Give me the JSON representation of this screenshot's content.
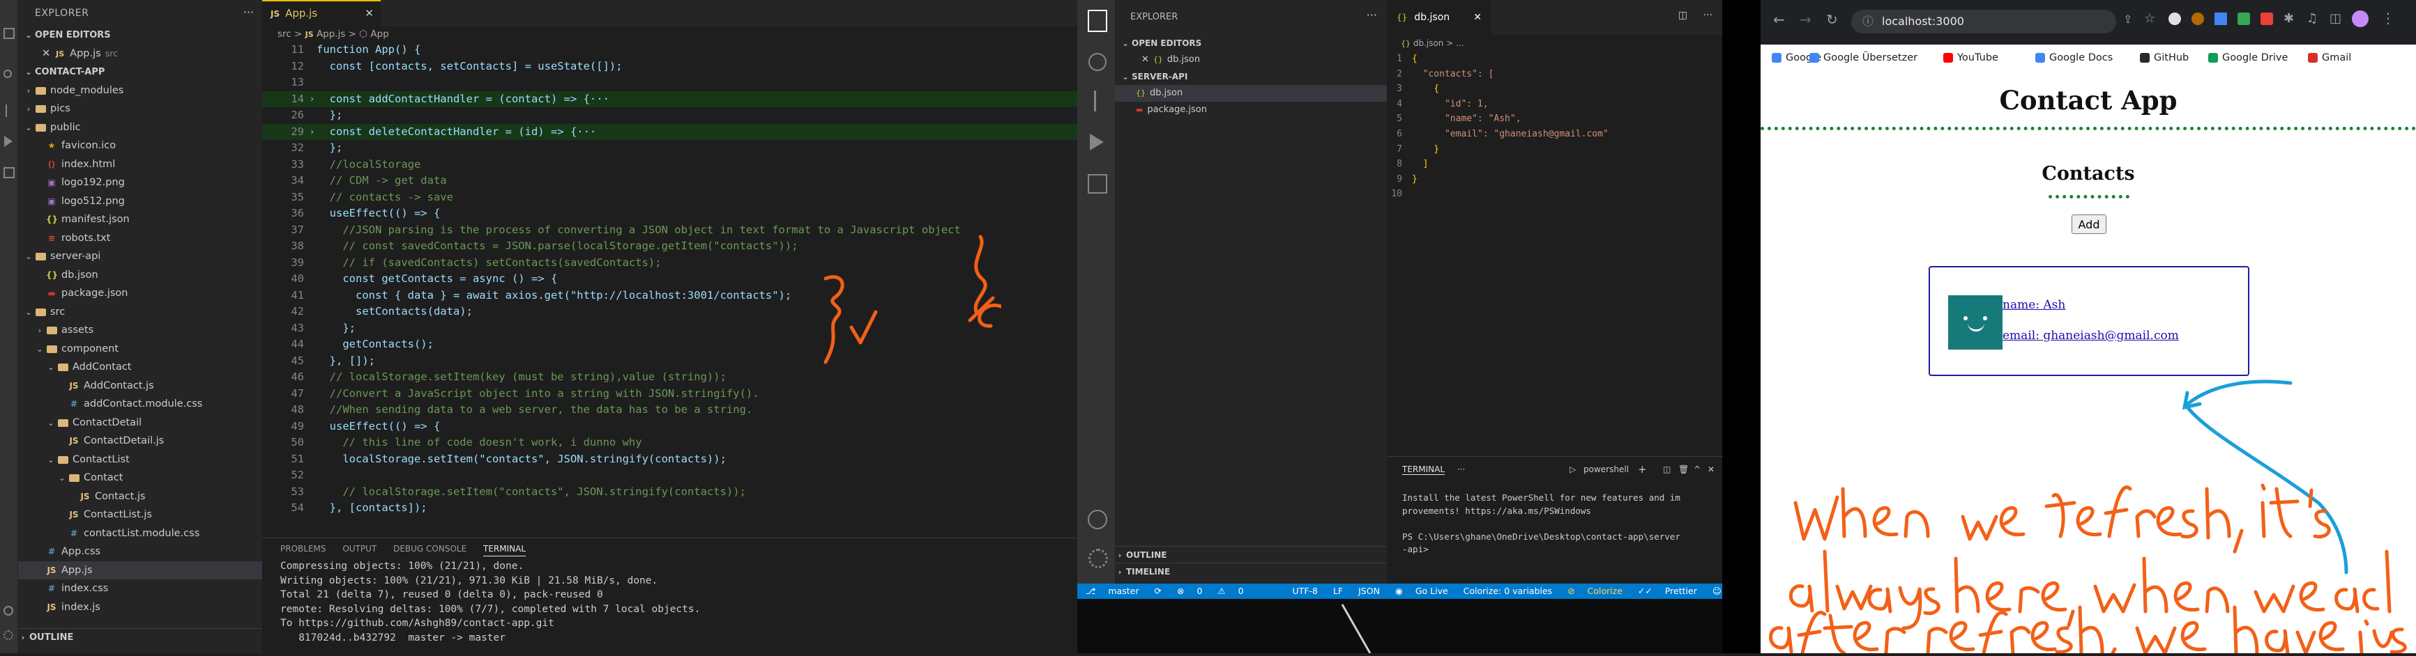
{
  "left_vscode": {
    "explorer_title": "EXPLORER",
    "open_editors_title": "OPEN EDITORS",
    "open_editor_file": "App.js",
    "open_editor_dir": "src",
    "project_title": "CONTACT-APP",
    "tree": [
      {
        "label": "node_modules",
        "kind": "folder",
        "depth": 1,
        "open": false
      },
      {
        "label": "pics",
        "kind": "folder",
        "depth": 1,
        "open": false
      },
      {
        "label": "public",
        "kind": "folder",
        "depth": 1,
        "open": true
      },
      {
        "label": "favicon.ico",
        "kind": "ico",
        "depth": 2
      },
      {
        "label": "index.html",
        "kind": "html",
        "depth": 2
      },
      {
        "label": "logo192.png",
        "kind": "png",
        "depth": 2
      },
      {
        "label": "logo512.png",
        "kind": "png",
        "depth": 2
      },
      {
        "label": "manifest.json",
        "kind": "json",
        "depth": 2
      },
      {
        "label": "robots.txt",
        "kind": "txt",
        "depth": 2
      },
      {
        "label": "server-api",
        "kind": "folder",
        "depth": 1,
        "open": true
      },
      {
        "label": "db.json",
        "kind": "json",
        "depth": 2
      },
      {
        "label": "package.json",
        "kind": "npm",
        "depth": 2
      },
      {
        "label": "src",
        "kind": "folder",
        "depth": 1,
        "open": true
      },
      {
        "label": "assets",
        "kind": "folder",
        "depth": 2,
        "open": false
      },
      {
        "label": "component",
        "kind": "folder",
        "depth": 2,
        "open": true
      },
      {
        "label": "AddContact",
        "kind": "folder",
        "depth": 3,
        "open": true
      },
      {
        "label": "AddContact.js",
        "kind": "js",
        "depth": 4
      },
      {
        "label": "addContact.module.css",
        "kind": "css",
        "depth": 4
      },
      {
        "label": "ContactDetail",
        "kind": "folder",
        "depth": 3,
        "open": true
      },
      {
        "label": "ContactDetail.js",
        "kind": "js",
        "depth": 4
      },
      {
        "label": "ContactList",
        "kind": "folder",
        "depth": 3,
        "open": true
      },
      {
        "label": "Contact",
        "kind": "folder",
        "depth": 4,
        "open": true
      },
      {
        "label": "Contact.js",
        "kind": "js",
        "depth": 5
      },
      {
        "label": "ContactList.js",
        "kind": "js",
        "depth": 4
      },
      {
        "label": "contactList.module.css",
        "kind": "css",
        "depth": 4
      },
      {
        "label": "App.css",
        "kind": "css",
        "depth": 2
      },
      {
        "label": "App.js",
        "kind": "js",
        "depth": 2,
        "active": true
      },
      {
        "label": "index.css",
        "kind": "css",
        "depth": 2
      },
      {
        "label": "index.js",
        "kind": "js",
        "depth": 2
      }
    ],
    "outline_title": "OUTLINE",
    "tab_label": "App.js",
    "breadcrumb": [
      "src",
      "App.js",
      "App"
    ],
    "code": [
      {
        "n": "11",
        "t": "function App() {"
      },
      {
        "n": "12",
        "t": "  const [contacts, setContacts] = useState([]);"
      },
      {
        "n": "13",
        "t": ""
      },
      {
        "n": "14",
        "t": "  const addContactHandler = (contact) => {···",
        "hl": true,
        "fold": true
      },
      {
        "n": "26",
        "t": "  };"
      },
      {
        "n": "29",
        "t": "  const deleteContactHandler = (id) => {···",
        "hl": true,
        "fold": true
      },
      {
        "n": "32",
        "t": "  };"
      },
      {
        "n": "33",
        "t": "  //localStorage"
      },
      {
        "n": "34",
        "t": "  // CDM -> get data"
      },
      {
        "n": "35",
        "t": "  // contacts -> save"
      },
      {
        "n": "36",
        "t": "  useEffect(() => {"
      },
      {
        "n": "37",
        "t": "    //JSON parsing is the process of converting a JSON object in text format to a Javascript object"
      },
      {
        "n": "38",
        "t": "    // const savedContacts = JSON.parse(localStorage.getItem(\"contacts\"));"
      },
      {
        "n": "39",
        "t": "    // if (savedContacts) setContacts(savedContacts);"
      },
      {
        "n": "40",
        "t": "    const getContacts = async () => {"
      },
      {
        "n": "41",
        "t": "      const { data } = await axios.get(\"http://localhost:3001/contacts\");"
      },
      {
        "n": "42",
        "t": "      setContacts(data);"
      },
      {
        "n": "43",
        "t": "    };"
      },
      {
        "n": "44",
        "t": "    getContacts();"
      },
      {
        "n": "45",
        "t": "  }, []);"
      },
      {
        "n": "46",
        "t": "  // localStorage.setItem(key (must be string),value (string));"
      },
      {
        "n": "47",
        "t": "  //Convert a JavaScript object into a string with JSON.stringify()."
      },
      {
        "n": "48",
        "t": "  //When sending data to a web server, the data has to be a string."
      },
      {
        "n": "49",
        "t": "  useEffect(() => {"
      },
      {
        "n": "50",
        "t": "    // this line of code doesn't work, i dunno why"
      },
      {
        "n": "51",
        "t": "    localStorage.setItem(\"contacts\", JSON.stringify(contacts));"
      },
      {
        "n": "52",
        "t": ""
      },
      {
        "n": "53",
        "t": "    // localStorage.setItem(\"contacts\", JSON.stringify(contacts));"
      },
      {
        "n": "54",
        "t": "  }, [contacts]);"
      }
    ],
    "panel_tabs": [
      "PROBLEMS",
      "OUTPUT",
      "DEBUG CONSOLE",
      "TERMINAL"
    ],
    "terminal": [
      "Compressing objects: 100% (21/21), done.",
      "Writing objects: 100% (21/21), 971.30 KiB | 21.58 MiB/s, done.",
      "Total 21 (delta 7), reused 0 (delta 0), pack-reused 0",
      "remote: Resolving deltas: 100% (7/7), completed with 7 local objects.",
      "To https://github.com/Ashgh89/contact-app.git",
      "   817024d..b432792  master -> master"
    ]
  },
  "mid_vscode": {
    "explorer_title": "EXPLORER",
    "open_editors_title": "OPEN EDITORS",
    "open_editor_file": "db.json",
    "project_title": "SERVER-API",
    "tree": [
      {
        "label": "db.json",
        "kind": "json",
        "active": true
      },
      {
        "label": "package.json",
        "kind": "npm"
      }
    ],
    "outline_title": "OUTLINE",
    "timeline_title": "TIMELINE",
    "tab_label": "db.json",
    "breadcrumb": [
      "db.json",
      "..."
    ],
    "code": [
      {
        "n": "1",
        "t": "{"
      },
      {
        "n": "2",
        "t": "  \"contacts\": ["
      },
      {
        "n": "3",
        "t": "    {"
      },
      {
        "n": "4",
        "t": "      \"id\": 1,"
      },
      {
        "n": "5",
        "t": "      \"name\": \"Ash\","
      },
      {
        "n": "6",
        "t": "      \"email\": \"ghaneiash@gmail.com\""
      },
      {
        "n": "7",
        "t": "    }"
      },
      {
        "n": "8",
        "t": "  ]"
      },
      {
        "n": "9",
        "t": "}"
      },
      {
        "n": "10",
        "t": ""
      }
    ],
    "terminal_title": "TERMINAL",
    "terminal_shell": "powershell",
    "terminal": [
      "Install the latest PowerShell for new features and im",
      "provements! https://aka.ms/PSWindows",
      "",
      "PS C:\\Users\\ghane\\OneDrive\\Desktop\\contact-app\\server",
      "-api>"
    ],
    "status": {
      "branch": "master",
      "errors": "0",
      "warnings": "0",
      "encoding": "UTF-8",
      "eol": "LF",
      "language": "JSON",
      "golive": "Go Live",
      "colorize_vars": "Colorize: 0 variables",
      "colorize": "Colorize",
      "prettier": "Prettier"
    }
  },
  "chrome": {
    "url": "localhost:3000",
    "bookmarks": [
      {
        "label": "Google",
        "color": "#4285f4"
      },
      {
        "label": "Google Übersetzer",
        "color": "#4285f4"
      },
      {
        "label": "YouTube",
        "color": "#ff0000"
      },
      {
        "label": "Google Docs",
        "color": "#4285f4"
      },
      {
        "label": "GitHub",
        "color": "#24292e"
      },
      {
        "label": "Google Drive",
        "color": "#0f9d58"
      },
      {
        "label": "Gmail",
        "color": "#d93025"
      }
    ],
    "page": {
      "title": "Contact App",
      "subtitle": "Contacts",
      "add_button": "Add",
      "contact_name": "name: Ash",
      "contact_email": "email: ghaneiash@gmail.com"
    }
  },
  "colors": {
    "accent_blue": "#007acc",
    "annotation_orange": "#f36017",
    "annotation_blue": "#1a9fd8",
    "app_green_border": "#1f7f3a",
    "avatar_teal": "#177a7a"
  }
}
